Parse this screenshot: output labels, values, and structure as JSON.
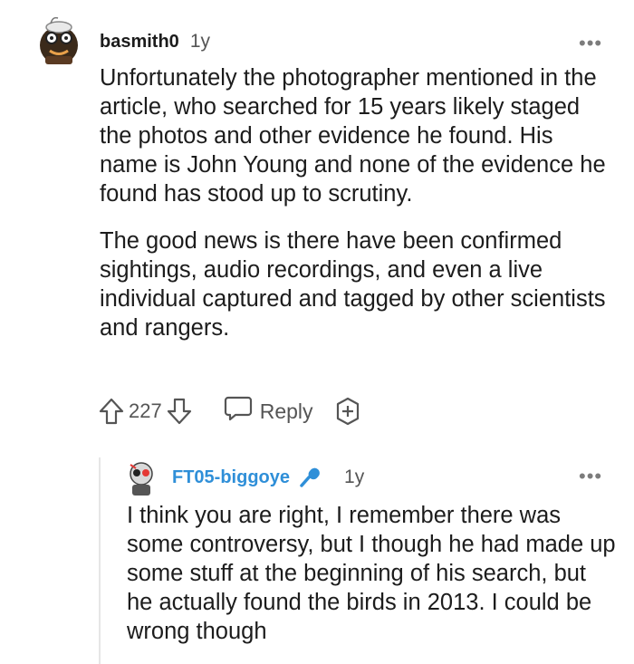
{
  "comment": {
    "username": "basmith0",
    "age": "1y",
    "more": "•••",
    "paragraphs": [
      "Unfortunately the photographer mentioned in the article, who searched for 15 years likely staged the photos and other evidence he found. His name is John Young and none of the evidence he found has stood up to scrutiny.",
      "The good news is there have been confirmed sightings, audio recordings, and even a live individual captured and tagged by other scientists and rangers."
    ],
    "score": "227",
    "reply_label": "Reply",
    "icons": [
      "upvote-icon",
      "downvote-icon",
      "reply-icon",
      "award-icon",
      "more-icon"
    ]
  },
  "reply": {
    "username": "FT05-biggoye",
    "age": "1y",
    "more": "•••",
    "text": "I think you are right, I remember there was some controversy, but I though he had made up some stuff at the beginning of his search, but he actually found the birds in 2013. I could be wrong though",
    "icons": [
      "microphone-icon",
      "more-icon"
    ]
  },
  "colors": {
    "username_reply": "#2f8fd8",
    "text": "#1c1c1c",
    "muted": "#555555",
    "thread_line": "#e6e6e6"
  }
}
